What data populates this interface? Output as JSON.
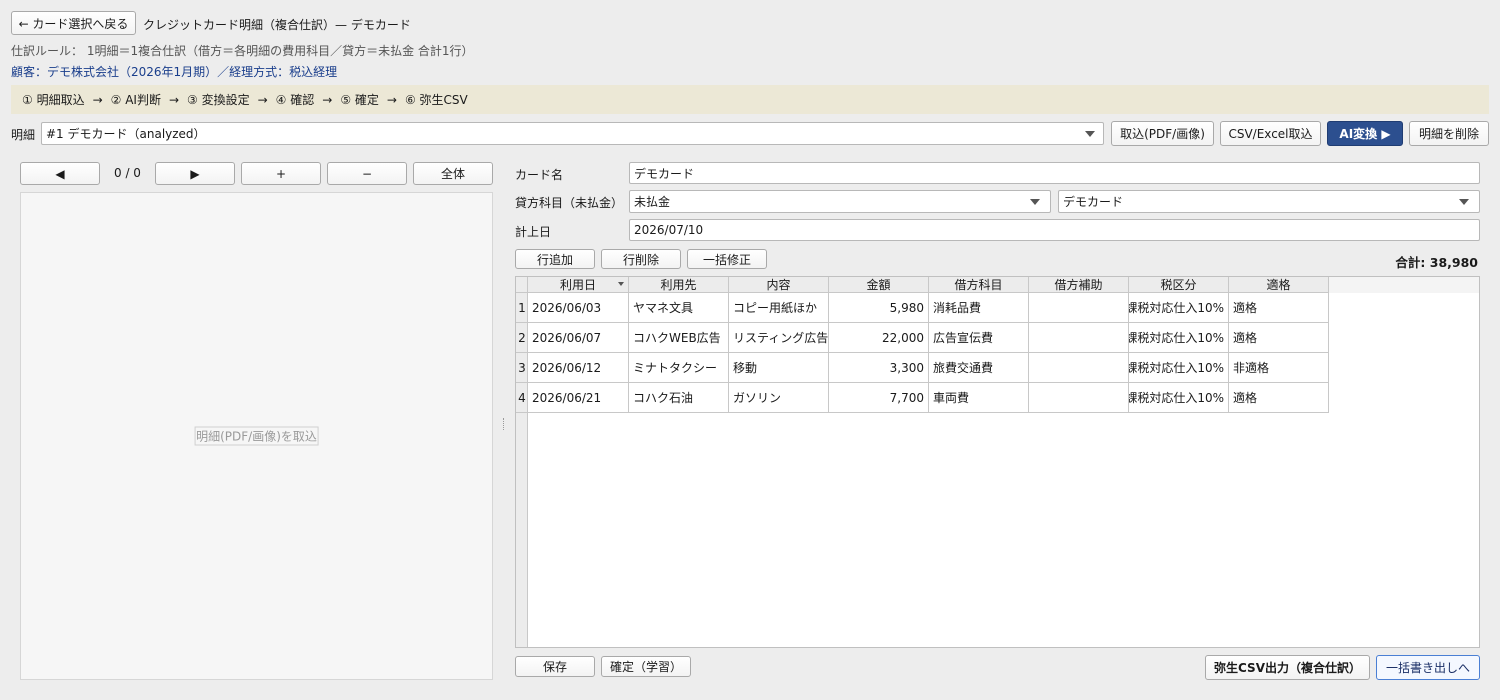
{
  "header": {
    "back_button": "← カード選択へ戻る",
    "title": "クレジットカード明細（複合仕訳）— デモカード",
    "rule": "仕訳ルール： 1明細＝1複合仕訳（借方＝各明細の費用科目／貸方＝未払金 合計1行）",
    "client": "顧客：デモ株式会社（2026年1月期）／経理方式：税込経理"
  },
  "steps": [
    "① 明細取込",
    "② AI判断",
    "③ 変換設定",
    "④ 確認",
    "⑤ 確定",
    "⑥ 弥生CSV"
  ],
  "step_arrow": "→",
  "toolbar": {
    "statement_label": "明細",
    "statement_value": "#1 デモカード（analyzed）",
    "import_pdf": "取込(PDF/画像)",
    "import_csv": "CSV/Excel取込",
    "ai_convert": "AI変換 ▶",
    "delete_statement": "明細を削除"
  },
  "viewer": {
    "prev": "◀",
    "page": "0 / 0",
    "next": "▶",
    "zoom_in": "+",
    "zoom_out": "−",
    "fit": "全体",
    "placeholder": "明細(PDF/画像)を取込"
  },
  "form": {
    "card_name_label": "カード名",
    "card_name_value": "デモカード",
    "credit_account_label": "貸方科目（未払金）",
    "credit_account_value": "未払金",
    "credit_sub_value": "デモカード",
    "posting_date_label": "計上日",
    "posting_date_value": "2026/07/10"
  },
  "grid_toolbar": {
    "add_row": "行追加",
    "delete_row": "行削除",
    "bulk_edit": "一括修正",
    "total": "合計: 38,980"
  },
  "table": {
    "columns": [
      "利用日",
      "利用先",
      "内容",
      "金額",
      "借方科目",
      "借方補助",
      "税区分",
      "適格"
    ],
    "rows": [
      {
        "no": "1",
        "date": "2026/06/03",
        "payee": "ヤマネ文具",
        "content": "コピー用紙ほか",
        "amount": "5,980",
        "debit": "消耗品費",
        "sub": "",
        "tax": "課税対応仕入10%",
        "qualified": "適格"
      },
      {
        "no": "2",
        "date": "2026/06/07",
        "payee": "コハクWEB広告",
        "content": "リスティング広告",
        "amount": "22,000",
        "debit": "広告宣伝費",
        "sub": "",
        "tax": "課税対応仕入10%",
        "qualified": "適格"
      },
      {
        "no": "3",
        "date": "2026/06/12",
        "payee": "ミナトタクシー",
        "content": "移動",
        "amount": "3,300",
        "debit": "旅費交通費",
        "sub": "",
        "tax": "課税対応仕入10%",
        "qualified": "非適格"
      },
      {
        "no": "4",
        "date": "2026/06/21",
        "payee": "コハク石油",
        "content": "ガソリン",
        "amount": "7,700",
        "debit": "車両費",
        "sub": "",
        "tax": "課税対応仕入10%",
        "qualified": "適格"
      }
    ]
  },
  "footer": {
    "save": "保存",
    "confirm": "確定（学習）",
    "yayoi_csv": "弥生CSV出力（複合仕訳）",
    "bulk_export": "一括書き出しへ"
  }
}
